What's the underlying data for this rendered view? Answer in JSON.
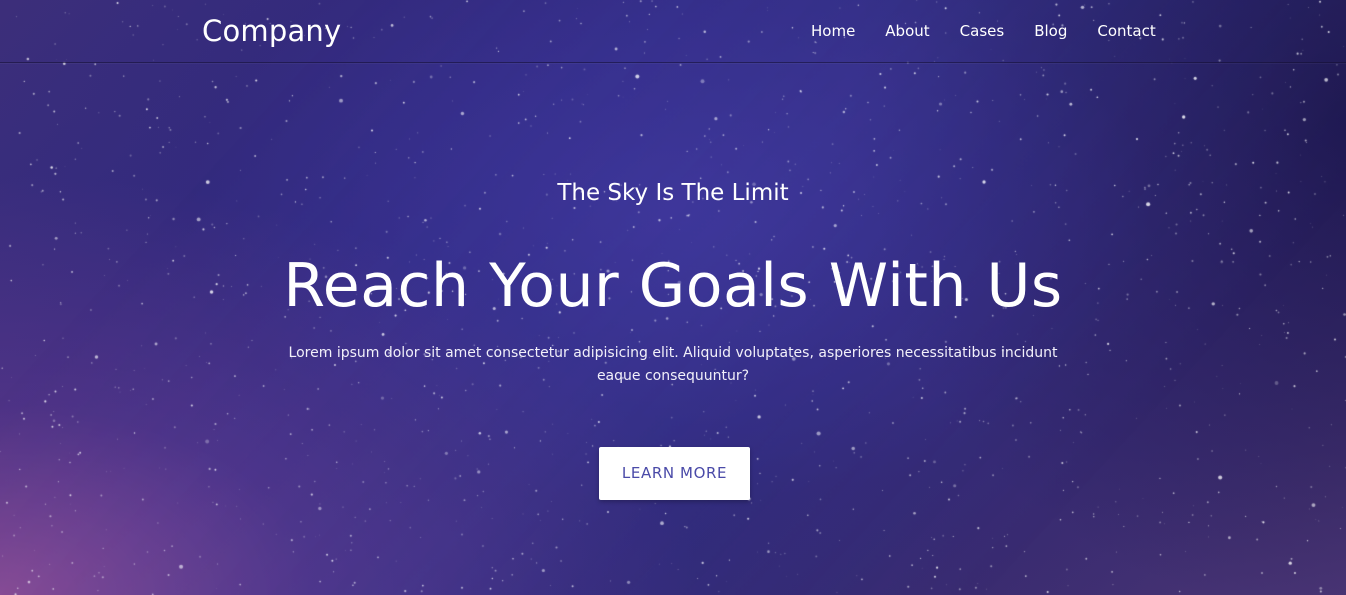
{
  "header": {
    "brand": "Company",
    "nav": [
      {
        "label": "Home"
      },
      {
        "label": "About"
      },
      {
        "label": "Cases"
      },
      {
        "label": "Blog"
      },
      {
        "label": "Contact"
      }
    ]
  },
  "hero": {
    "tagline": "The Sky Is The Limit",
    "headline": "Reach Your Goals With Us",
    "lead": "Lorem ipsum dolor sit amet consectetur adipisicing elit. Aliquid voluptates, asperiores necessitatibus incidunt eaque consequuntur?",
    "cta_label": "LEARN MORE"
  },
  "colors": {
    "background_deep": "#2e2a86",
    "background_purple": "#4a3575",
    "cta_text": "#4a4aa8",
    "text": "#ffffff"
  }
}
